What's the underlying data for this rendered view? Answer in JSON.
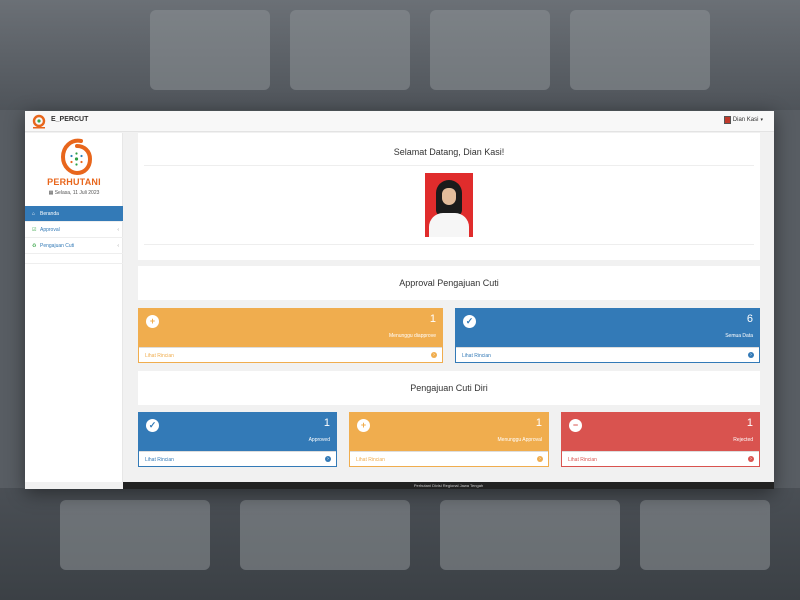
{
  "app": {
    "brand": "E_PERCUT",
    "user_menu": "Dian Kasi"
  },
  "sidebar": {
    "org": "PERHUTANI",
    "date": "Selasa, 11 Juli 2023",
    "items": [
      {
        "label": "Beranda",
        "icon": "home-icon",
        "active": true
      },
      {
        "label": "Approval",
        "icon": "check-square-icon"
      },
      {
        "label": "Pengajuan Cuti",
        "icon": "recycle-icon"
      }
    ]
  },
  "welcome": {
    "title": "Selamat Datang, Dian Kasi!"
  },
  "approval": {
    "title": "Approval Pengajuan Cuti",
    "cards": [
      {
        "count": "1",
        "label": "Menunggu diapprove",
        "link": "Lihat Rincian",
        "icon": "plus-circle-icon",
        "color": "#f0ad4e"
      },
      {
        "count": "6",
        "label": "Semua Data",
        "link": "Lihat Rincian",
        "icon": "check-circle-icon",
        "color": "#337ab7"
      }
    ]
  },
  "own": {
    "title": "Pengajuan Cuti Diri",
    "cards": [
      {
        "count": "1",
        "label": "Approved",
        "link": "Lihat Rincian",
        "icon": "check-circle-icon",
        "color": "#337ab7"
      },
      {
        "count": "1",
        "label": "Menunggu Approval",
        "link": "Lihat Rincian",
        "icon": "plus-circle-icon",
        "color": "#f0ad4e"
      },
      {
        "count": "1",
        "label": "Rejected",
        "link": "Lihat Rincian",
        "icon": "minus-circle-icon",
        "color": "#d9534f"
      }
    ]
  },
  "footer": {
    "text": "Perhutani Divisi Regional Jawa Tengah"
  }
}
